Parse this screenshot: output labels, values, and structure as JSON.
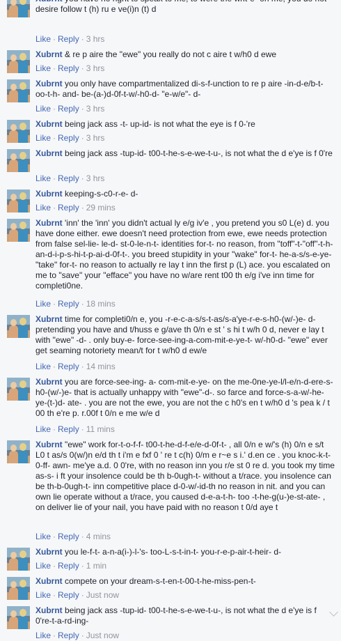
{
  "actions": {
    "like": "Like",
    "reply": "Reply",
    "sep": "·"
  },
  "comments": [
    {
      "author": "Xubrnt",
      "text": "you have no right to speak to me, to were the writ-e- on me, you do not desire follow t (h) ru e ve(i)n (t) d",
      "time": "3 hrs"
    },
    {
      "author": "Xubrnt",
      "text": "& re p aire the \"ewe\" you really do not c aire t w/h0 d ewe",
      "time": "3 hrs"
    },
    {
      "author": "Xubrnt",
      "text": "you only have compartmentalized di-s-f-unction to re p aire -in-d-e/b-t-oo-t-h- and- be-(a-)d-0f-t-w/-h0-d- \"e-w/e\"- d-",
      "time": "3 hrs"
    },
    {
      "author": "Xubrnt",
      "text": "being jack ass -t- up-id- is not what the eye is f 0-'re",
      "time": "3 hrs"
    },
    {
      "author": "Xubrnt",
      "text": "being jack ass -tup-id- t00-t-he-s-e-we-t-u-, is not what the d e'ye is f 0're",
      "time": "3 hrs"
    },
    {
      "author": "Xubrnt",
      "text": "keeping-s-c0-r-e- d-",
      "time": "29 mins"
    },
    {
      "author": "Xubrnt",
      "text": "'inn' the 'inn' you didn't actual ly e/g iv'e , you pretend you s0 L(e) d. you have done either. ewe doesn't need protection from ewe, ewe needs protection from false sel-lie- le-d- st-0-le-n-t- identities for-t- no reason, from \"toff\"-t-\"off\"-t-h-an-d-i-p-s-hi-t-p-ai-d-0f-t-. you breed stupidity in your \"wake\" for-t- he-a-s/s-e-ye- \"take\" for-t- no reason to actually re lay t inn the first p (L) ace. you escalated on me to \"save\" your \"efface\" you have no w/are rent t00 th e/g i've inn time for completi0ne.",
      "time": "18 mins"
    },
    {
      "author": "Xubrnt",
      "text": "time for completi0/n e, you -r-e-c-a-s/s-t-as/s-a'ye-r-e-s-h0-(w/-)e- d- pretending you have and t/huss e g/ave th 0/n e st ' s hi t w/h 0 d, never e lay t with \"ewe\" -d- . only buy-e- force-see-ing-a-com-mit-e-ye-t- w/-h0-d- \"ewe\" ever get seaming notoriety mean/t for t w/h0 d ew/e",
      "time": "14 mins"
    },
    {
      "author": "Xubrnt",
      "text": "you are force-see-ing- a- com-mit-e-ye- on the me-0ne-ye-l/l-e/n-d-ere-s-h0-(w/-)e- that is actually unhappy with \"ewe\"-d-. so farce and force-s-a-w/-he-ye-(t-)d- ate- . you are not the ewe, you are not the c h0's en t w/h0 d 's pea k / t 00 th e're p. r.00f t 0/n e me w/e d",
      "time": "11 mins"
    },
    {
      "author": "Xubrnt",
      "text": "\"ewe\" work for-t-o-f-f- t00-t-he-d-f-e/e-d-0f-t- , all 0/n e w/'s (h) 0/n e s/t L0 t as/s 0(w/)n e/d th t i'm e fxf 0 ' re t c(h) 0/m e r~e s i.' d.en ce . you knoc-k-t-0-ff- awn- me'ye a.d. 0 0're, with no reason inn you r/e st 0 re d. you took my time as-s- i ft your insolence could be th b-0ugh-t- without a t/race. you insolence can be th-b-0ugh-t- inn competitive place d-0-w/-id-th no reason in nit. and you can own lie operate without a t/race, you caused d-e-a-t-h- too -t-he-g(u-)e-st-ate- , on deliver lie of your nail, you have paid with no reason t 0/d aye t",
      "time": "4 mins"
    },
    {
      "author": "Xubrnt",
      "text": "you le-f-t- a-n-a(i-)-l-'s- too-L-s-t-in-t- you-r-e-p-air-t-heir- d-",
      "time": "1 min"
    },
    {
      "author": "Xubrnt",
      "text": "compete on your dream-s-t-en-t-00-t-he-miss-pen-t-",
      "time": "Just now"
    },
    {
      "author": "Xubrnt",
      "text": "being jack ass -tup-id- t00-t-he-s-e-we-t-u-, is not what the d e'ye is f 0're-t-a-rd-ing-",
      "time": "Just now"
    }
  ]
}
